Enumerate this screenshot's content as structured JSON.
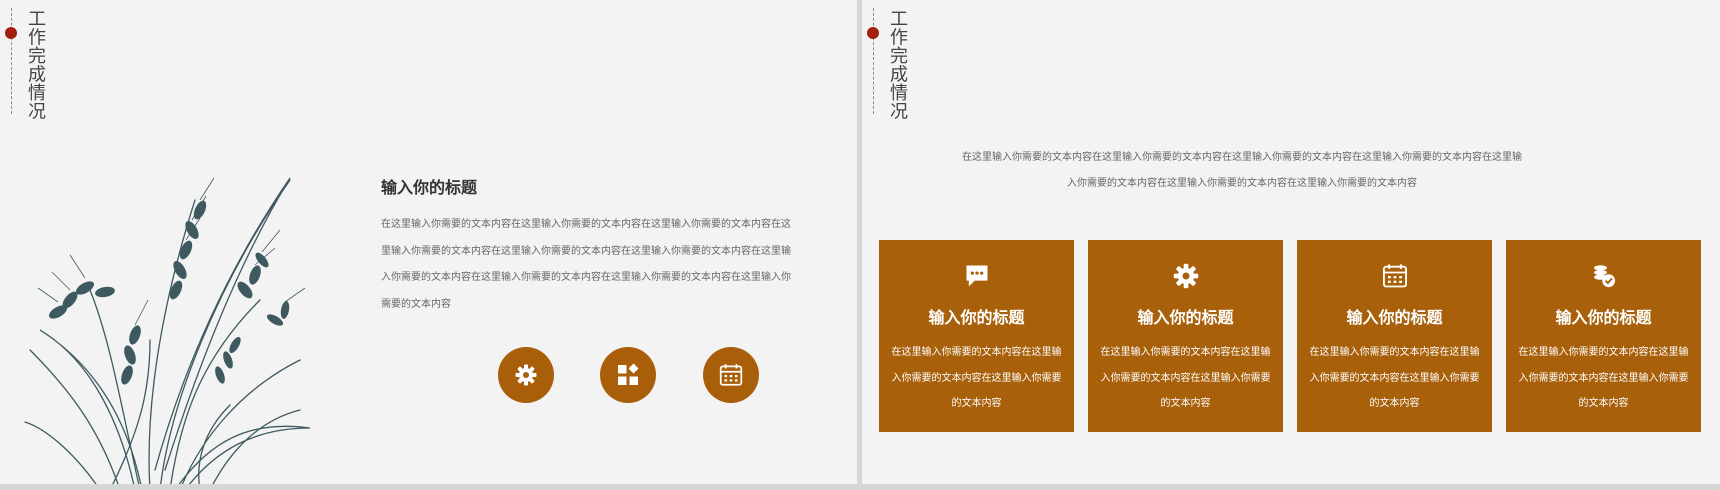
{
  "section_title": "工作完成情况",
  "left_slide": {
    "heading": "输入你的标题",
    "body": "在这里输入你需要的文本内容在这里输入你需要的文本内容在这里输入你需要的文本内容在这里输入你需要的文本内容在这里输入你需要的文本内容在这里输入你需要的文本内容在这里输入你需要的文本内容在这里输入你需要的文本内容在这里输入你需要的文本内容在这里输入你需要的文本内容",
    "buttons": [
      {
        "icon": "gear-icon"
      },
      {
        "icon": "widgets-icon"
      },
      {
        "icon": "calendar-icon"
      }
    ]
  },
  "right_slide": {
    "intro": "在这里输入你需要的文本内容在这里输入你需要的文本内容在这里输入你需要的文本内容在这里输入你需要的文本内容在这里输入你需要的文本内容在这里输入你需要的文本内容在这里输入你需要的文本内容",
    "cards": [
      {
        "icon": "chat-icon",
        "title": "输入你的标题",
        "body": "在这里输入你需要的文本内容在这里输入你需要的文本内容在这里输入你需要的文本内容"
      },
      {
        "icon": "gear-icon",
        "title": "输入你的标题",
        "body": "在这里输入你需要的文本内容在这里输入你需要的文本内容在这里输入你需要的文本内容"
      },
      {
        "icon": "calendar-icon",
        "title": "输入你的标题",
        "body": "在这里输入你需要的文本内容在这里输入你需要的文本内容在这里输入你需要的文本内容"
      },
      {
        "icon": "coins-icon",
        "title": "输入你的标题",
        "body": "在这里输入你需要的文本内容在这里输入你需要的文本内容在这里输入你需要的文本内容"
      }
    ]
  },
  "colors": {
    "accent": "#a95f0a",
    "dot": "#a3200e",
    "background": "#f3f3f3",
    "plant": "#3e5a60"
  }
}
